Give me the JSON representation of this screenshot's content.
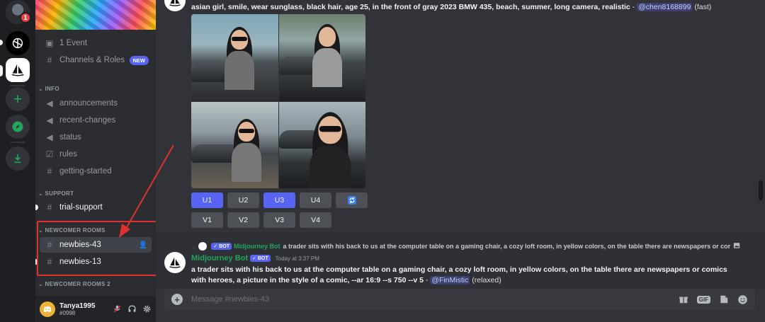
{
  "rail": {
    "notification_count": "1"
  },
  "sidebar": {
    "top_items": [
      {
        "label": "1 Event",
        "icon": "calendar-icon"
      },
      {
        "label": "Channels & Roles",
        "icon": "hashtag-icon",
        "badge": "NEW"
      }
    ],
    "categories": {
      "info": "INFO",
      "support": "SUPPORT",
      "newcomer": "NEWCOMER ROOMS",
      "newcomer2": "NEWCOMER ROOMS 2"
    },
    "info_channels": [
      {
        "label": "announcements",
        "icon": "megaphone-icon"
      },
      {
        "label": "recent-changes",
        "icon": "megaphone-icon"
      },
      {
        "label": "status",
        "icon": "megaphone-icon"
      },
      {
        "label": "rules",
        "icon": "checkbox-icon"
      },
      {
        "label": "getting-started",
        "icon": "hashtag-icon"
      }
    ],
    "support_channels": [
      {
        "label": "trial-support",
        "icon": "hashtag-icon"
      }
    ],
    "newcomer_channels": [
      {
        "label": "newbies-43",
        "icon": "hashtag-thread-icon"
      },
      {
        "label": "newbies-13",
        "icon": "hashtag-thread-icon"
      }
    ]
  },
  "user": {
    "name": "Tanya1995",
    "tag": "#0998"
  },
  "chat": {
    "message1": {
      "prompt": "asian girl, smile, wear sunglass, black hair, age 25, in the front of gray 2023 BMW 435, beach, summer, long camera, realistic",
      "separator": " - ",
      "mention": "@chen8168899",
      "mode": " (fast)"
    },
    "buttons_row1": [
      "U1",
      "U2",
      "U3",
      "U4"
    ],
    "buttons_row2": [
      "V1",
      "V2",
      "V3",
      "V4"
    ],
    "message2": {
      "reply_bot": "Midjourney Bot",
      "reply_badge": "✓ BOT",
      "reply_text": "a trader sits with his back to us at the computer table on a gaming chair, a cozy loft room, in yellow colors, on the table there are newspapers or cor",
      "author": "Midjourney Bot",
      "badge": "✓ BOT",
      "timestamp": "Today at 3:37 PM",
      "text": "a trader sits with his back to us at the computer table on a gaming chair, a cozy loft room, in yellow colors, on the table there are newspapers or comics with heroes, a picture in the style of a comic, --ar 16:9 --s 750 --v 5",
      "separator": " - ",
      "mention": "@FinMistic",
      "mode": " (relaxed)"
    },
    "input_placeholder": "Message #newbies-43",
    "gif_label": "GIF"
  },
  "colors": {
    "accent": "#5865f2",
    "bot_green": "#23a55a",
    "annotation_red": "#e03131"
  }
}
